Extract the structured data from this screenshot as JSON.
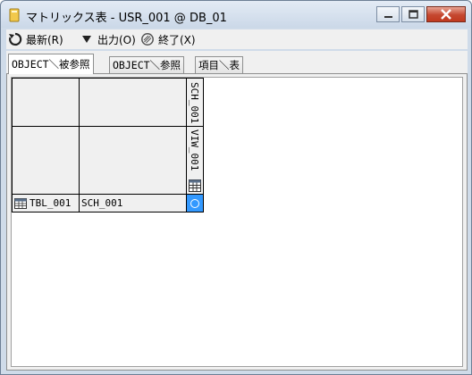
{
  "window": {
    "title": "マトリックス表 - USR_001 @ DB_01"
  },
  "toolbar": {
    "refresh_label": "最新(R)",
    "output_label": "出力(O)",
    "exit_label": "終了(X)"
  },
  "tabs": [
    {
      "label": "OBJECT＼被参照",
      "active": true
    },
    {
      "label": "OBJECT＼参照",
      "active": false
    },
    {
      "label": "項目＼表",
      "active": false
    }
  ],
  "matrix": {
    "columns": [
      {
        "label": "SCH_001"
      },
      {
        "label": "VIW_001",
        "icon": "table-icon"
      }
    ],
    "rows": [
      {
        "object": "TBL_001",
        "icon": "table-icon",
        "schema": "SCH_001",
        "mark": "○"
      }
    ]
  },
  "colors": {
    "selected_cell": "#3399ff",
    "title_bar": "#cbd8e8"
  }
}
